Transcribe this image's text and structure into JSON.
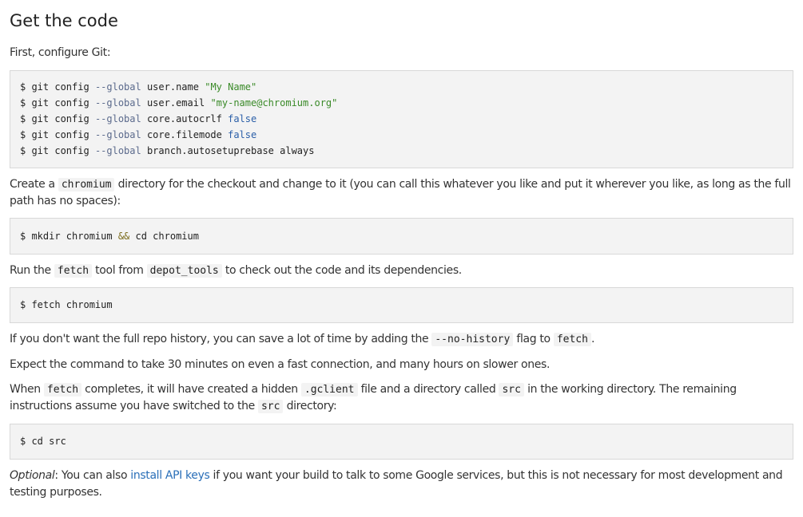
{
  "title": "Get the code",
  "intro": "First, configure Git:",
  "git_config": [
    {
      "prompt": "$ ",
      "cmd": "git config ",
      "flag": "--global",
      "key": " user.name ",
      "value": "\"My Name\"",
      "value_type": "str"
    },
    {
      "prompt": "$ ",
      "cmd": "git config ",
      "flag": "--global",
      "key": " user.email ",
      "value": "\"my-name@chromium.org\"",
      "value_type": "str"
    },
    {
      "prompt": "$ ",
      "cmd": "git config ",
      "flag": "--global",
      "key": " core.autocrlf ",
      "value": "false",
      "value_type": "lit"
    },
    {
      "prompt": "$ ",
      "cmd": "git config ",
      "flag": "--global",
      "key": " core.filemode ",
      "value": "false",
      "value_type": "lit"
    },
    {
      "prompt": "$ ",
      "cmd": "git config ",
      "flag": "--global",
      "key": " branch.autosetuprebase always",
      "value": "",
      "value_type": "plain"
    }
  ],
  "p_create": {
    "before": "Create a ",
    "code": "chromium",
    "after": " directory for the checkout and change to it (you can call this whatever you like and put it wherever you like, as long as the full path has no spaces):"
  },
  "mkdir_cmd": {
    "prompt": "$ ",
    "part1": "mkdir chromium ",
    "op": "&&",
    "part2": " cd chromium"
  },
  "p_run": {
    "before": "Run the ",
    "code1": "fetch",
    "mid": " tool from ",
    "code2": "depot_tools",
    "after": " to check out the code and its dependencies."
  },
  "fetch_cmd": "$ fetch chromium",
  "p_history": {
    "before": "If you don't want the full repo history, you can save a lot of time by adding the ",
    "code1": "--no-history",
    "mid": " flag to ",
    "code2": "fetch",
    "after": "."
  },
  "p_expect": "Expect the command to take 30 minutes on even a fast connection, and many hours on slower ones.",
  "p_when": {
    "t1": "When ",
    "c1": "fetch",
    "t2": " completes, it will have created a hidden ",
    "c2": ".gclient",
    "t3": " file and a directory called ",
    "c3": "src",
    "t4": " in the working directory. The remaining instructions assume you have switched to the ",
    "c4": "src",
    "t5": " directory:"
  },
  "cd_cmd": "$ cd src",
  "p_optional": {
    "em": "Optional",
    "t1": ": You can also ",
    "link": "install API keys",
    "t2": " if you want your build to talk to some Google services, but this is not necessary for most development and testing purposes."
  }
}
